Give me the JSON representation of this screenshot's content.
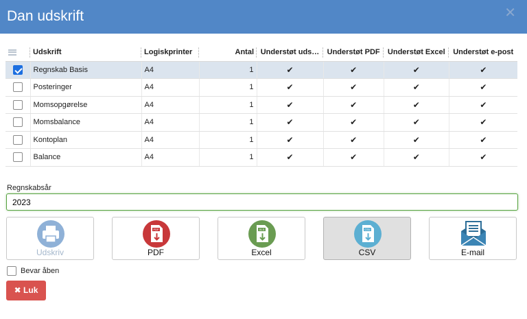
{
  "dialog": {
    "title": "Dan udskrift"
  },
  "table": {
    "columns": [
      "Udskrift",
      "Logiskprinter",
      "Antal",
      "Understøt uds…",
      "Understøt PDF",
      "Understøt Excel",
      "Understøt e-post"
    ],
    "rows": [
      {
        "name": "Regnskab Basis",
        "printer": "A4",
        "count": "1",
        "checked": true,
        "tick": "✔"
      },
      {
        "name": "Posteringer",
        "printer": "A4",
        "count": "1",
        "checked": false,
        "tick": "✔"
      },
      {
        "name": "Momsopgørelse",
        "printer": "A4",
        "count": "1",
        "checked": false,
        "tick": "✔"
      },
      {
        "name": "Momsbalance",
        "printer": "A4",
        "count": "1",
        "checked": false,
        "tick": "✔"
      },
      {
        "name": "Kontoplan",
        "printer": "A4",
        "count": "1",
        "checked": false,
        "tick": "✔"
      },
      {
        "name": "Balance",
        "printer": "A4",
        "count": "1",
        "checked": false,
        "tick": "✔"
      }
    ]
  },
  "year": {
    "label": "Regnskabsår",
    "value": "2023"
  },
  "actions": {
    "print": "Udskriv",
    "pdf": "PDF",
    "excel": "Excel",
    "csv": "CSV",
    "email": "E-mail",
    "icon_texts": {
      "pdf": "PDF",
      "excel": "XLS",
      "csv": "CSV"
    }
  },
  "keep_open": {
    "label": "Bevar åben",
    "checked": false
  },
  "close_button": {
    "label": "Luk",
    "icon": "✖"
  },
  "colors": {
    "titlebar": "#5187c7",
    "selected_row": "#dbe4ee",
    "print_icon": "#8fb1d7",
    "pdf_icon": "#c8383a",
    "excel_icon": "#6a9c52",
    "csv_icon": "#5cafd2",
    "email_icon": "#2d6e98",
    "close_button": "#d9534f"
  }
}
